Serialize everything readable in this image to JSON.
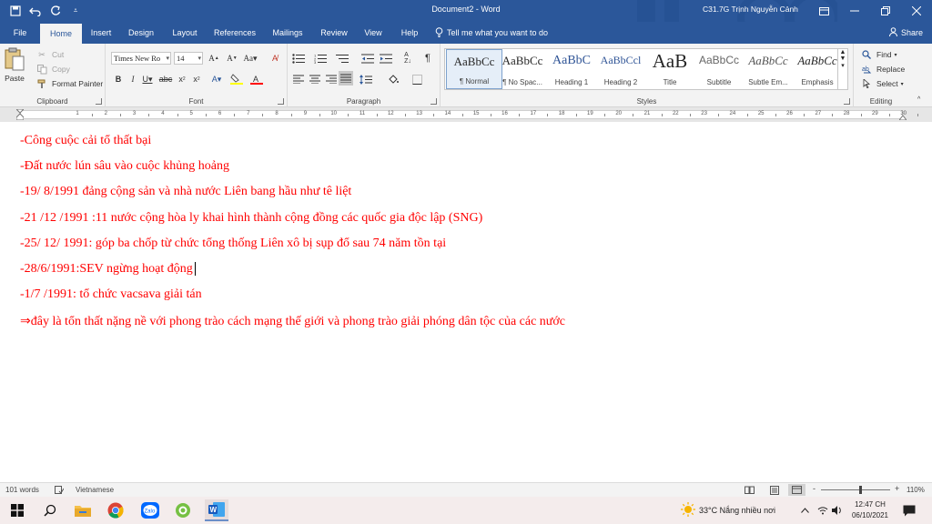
{
  "window": {
    "title": "Document2 - Word",
    "user": "C31.7G Trịnh Nguyễn Cảnh",
    "share": "Share"
  },
  "tabs": [
    "File",
    "Home",
    "Insert",
    "Design",
    "Layout",
    "References",
    "Mailings",
    "Review",
    "View",
    "Help"
  ],
  "tell_me": "Tell me what you want to do",
  "clipboard": {
    "group": "Clipboard",
    "paste": "Paste",
    "cut": "Cut",
    "copy": "Copy",
    "format_painter": "Format Painter"
  },
  "font": {
    "group": "Font",
    "family": "Times New Ro",
    "size": "14"
  },
  "paragraph": {
    "group": "Paragraph"
  },
  "styles": {
    "group": "Styles",
    "items": [
      {
        "preview": "AaBbCc",
        "name": "¶ Normal"
      },
      {
        "preview": "AaBbCc",
        "name": "¶ No Spac..."
      },
      {
        "preview": "AaBbC",
        "name": "Heading 1"
      },
      {
        "preview": "AaBbCcl",
        "name": "Heading 2"
      },
      {
        "preview": "AaB",
        "name": "Title"
      },
      {
        "preview": "AaBbCc",
        "name": "Subtitle"
      },
      {
        "preview": "AaBbCc",
        "name": "Subtle Em..."
      },
      {
        "preview": "AaBbCc",
        "name": "Emphasis"
      }
    ]
  },
  "editing": {
    "group": "Editing",
    "find": "Find",
    "replace": "Replace",
    "select": "Select"
  },
  "ruler": [
    "1",
    "2",
    "3",
    "4",
    "5",
    "6",
    "7",
    "8",
    "9",
    "10",
    "11",
    "12",
    "13",
    "14",
    "15",
    "16",
    "17",
    "18",
    "19",
    "20",
    "21",
    "22",
    "23",
    "24",
    "25",
    "26",
    "27",
    "28",
    "29",
    "30"
  ],
  "document": {
    "lines": [
      "-Công cuộc cải tổ thất bại",
      "-Đất nước lún sâu vào cuộc khủng hoảng",
      "-19/ 8/1991 đảng cộng sản và nhà nước Liên bang hầu như tê liệt",
      "-21 /12 /1991 :11 nước cộng hòa ly khai hình thành cộng đồng các quốc gia độc lập (SNG)",
      "-25/ 12/ 1991: góp ba chốp từ chức tổng thống Liên xô bị sụp đổ sau 74 năm tồn tại",
      "-28/6/1991:SEV ngừng hoạt động",
      "-1/7 /1991: tổ chức vacsava giải tán",
      "⇒đây là tổn thất nặng nề với phong trào cách mạng thế giới và phong trào giải phóng dân tộc của các nước"
    ]
  },
  "status": {
    "words": "101 words",
    "language": "Vietnamese",
    "zoom": "110%",
    "zoom_minus": "-",
    "zoom_plus": "+"
  },
  "taskbar": {
    "weather": "33°C  Nắng nhiều nơi",
    "time": "12:47 CH",
    "date": "06/10/2021"
  }
}
